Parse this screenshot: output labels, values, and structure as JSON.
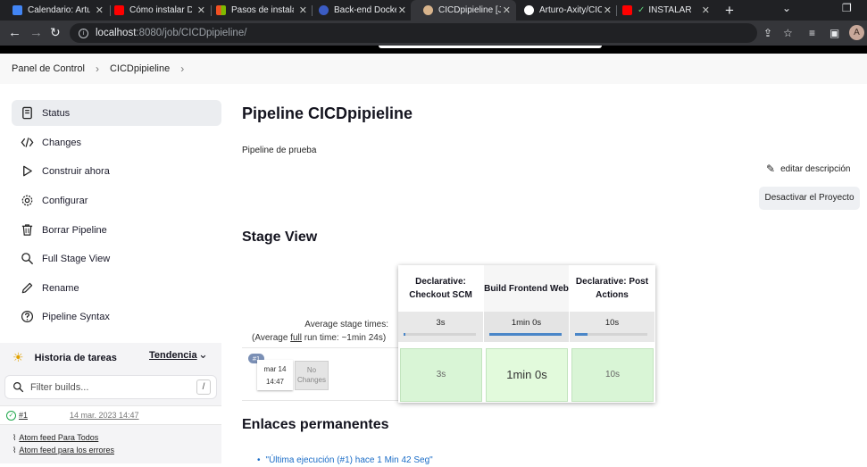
{
  "browser": {
    "tabs": [
      {
        "title": "Calendario: Arturo",
        "favicon_color": "#4285f4"
      },
      {
        "title": "Cómo instalar Do",
        "favicon_color": "#ff0000"
      },
      {
        "title": "Pasos de instalac",
        "favicon_color": "#f25022"
      },
      {
        "title": "Back-end Docker",
        "favicon_color": "#3b5cc4"
      },
      {
        "title": "CICDpipieline [Je",
        "favicon_color": "#d8b48c",
        "active": true
      },
      {
        "title": "Arturo-Axity/CIC",
        "favicon_color": "#ffffff"
      },
      {
        "title": "INSTALAR W",
        "favicon_color": "#ff0000"
      }
    ],
    "new_tab_icon": "+",
    "url_host": "localhost",
    "url_path": ":8080/job/CICDpipieline/",
    "avatar_letter": "A"
  },
  "breadcrumb": {
    "items": [
      "Panel de Control",
      "CICDpipieline"
    ]
  },
  "sidebar": {
    "items": [
      {
        "label": "Status",
        "icon": "document-icon"
      },
      {
        "label": "Changes",
        "icon": "code-icon"
      },
      {
        "label": "Construir ahora",
        "icon": "play-icon"
      },
      {
        "label": "Configurar",
        "icon": "gear-icon"
      },
      {
        "label": "Borrar Pipeline",
        "icon": "trash-icon"
      },
      {
        "label": "Full Stage View",
        "icon": "search-icon"
      },
      {
        "label": "Rename",
        "icon": "pencil-icon"
      },
      {
        "label": "Pipeline Syntax",
        "icon": "help-icon"
      }
    ],
    "history": {
      "title": "Historia de tareas",
      "trend": "Tendencia",
      "filter_placeholder": "Filter builds...",
      "filter_shortcut": "/",
      "builds": [
        {
          "number": "#1",
          "date": "14 mar. 2023 14:47"
        }
      ],
      "feeds": [
        "Atom feed Para Todos",
        "Atom feed para los errores"
      ]
    }
  },
  "main": {
    "title": "Pipeline CICDpipieline",
    "description": "Pipeline de prueba",
    "edit_description": "editar descripción",
    "disable_button": "Desactivar el Proyecto",
    "stage_view_title": "Stage View",
    "stage_view": {
      "avg_label": "Average stage times:",
      "avg_full_prefix": "(Average ",
      "avg_full_word": "full",
      "avg_full_suffix": " run time: ~1min 24s)",
      "stages": [
        {
          "name": "Declarative: Checkout SCM",
          "avg": "3s",
          "avg_fraction": 0.03,
          "cell": "3s"
        },
        {
          "name": "Build Frontend Web",
          "avg": "1min 0s",
          "avg_fraction": 1.0,
          "cell": "1min 0s"
        },
        {
          "name": "Declarative: Post Actions",
          "avg": "10s",
          "avg_fraction": 0.17,
          "cell": "10s"
        }
      ],
      "build": {
        "badge": "#1",
        "date": "mar 14",
        "time": "14:47",
        "no_changes": "No Changes"
      }
    },
    "permalinks_title": "Enlaces permanentes",
    "permalinks": [
      "\"Última ejecución (#1) hace 1 Min 42 Seg\""
    ]
  }
}
